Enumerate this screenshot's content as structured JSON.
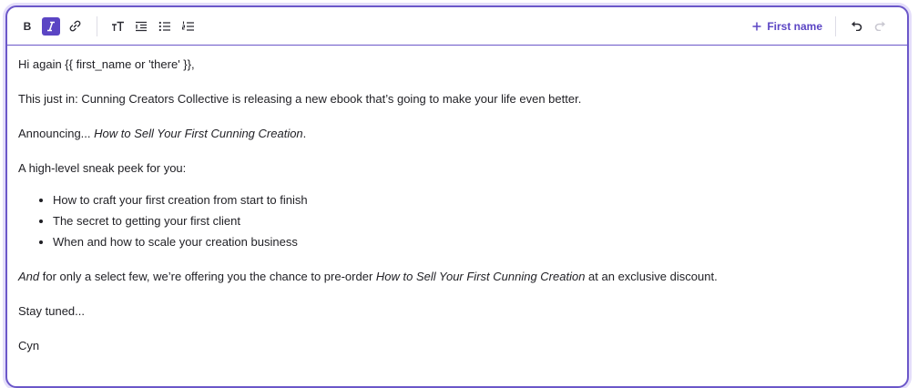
{
  "toolbar": {
    "bold_label": "B",
    "icons": [
      "bold-icon",
      "italic-icon",
      "link-icon",
      "text-size-icon",
      "indent-icon",
      "bulleted-list-icon",
      "numbered-list-icon",
      "undo-icon",
      "redo-icon"
    ],
    "active_tool": "italic",
    "insert_field_label": "First name",
    "accent_color": "#5b45c4"
  },
  "body": {
    "greeting": "Hi again {{ first_name or 'there' }},",
    "p1": "This just in: Cunning Creators Collective is releasing a new ebook that’s going to make your life even better.",
    "p2_prefix": "Announcing... ",
    "book_title": "How to Sell Your First Cunning Creation",
    "p2_suffix": ".",
    "p3": "A high-level sneak peek for you:",
    "bullets": [
      "How to craft your first creation from start to finish",
      "The secret to getting your first client",
      "When and how to scale your creation business"
    ],
    "p4_em": "And",
    "p4_mid": " for only a select few, we’re offering you the chance to pre-order ",
    "p4_suffix": " at an exclusive discount.",
    "p5": "Stay tuned...",
    "signature": "Cyn"
  }
}
